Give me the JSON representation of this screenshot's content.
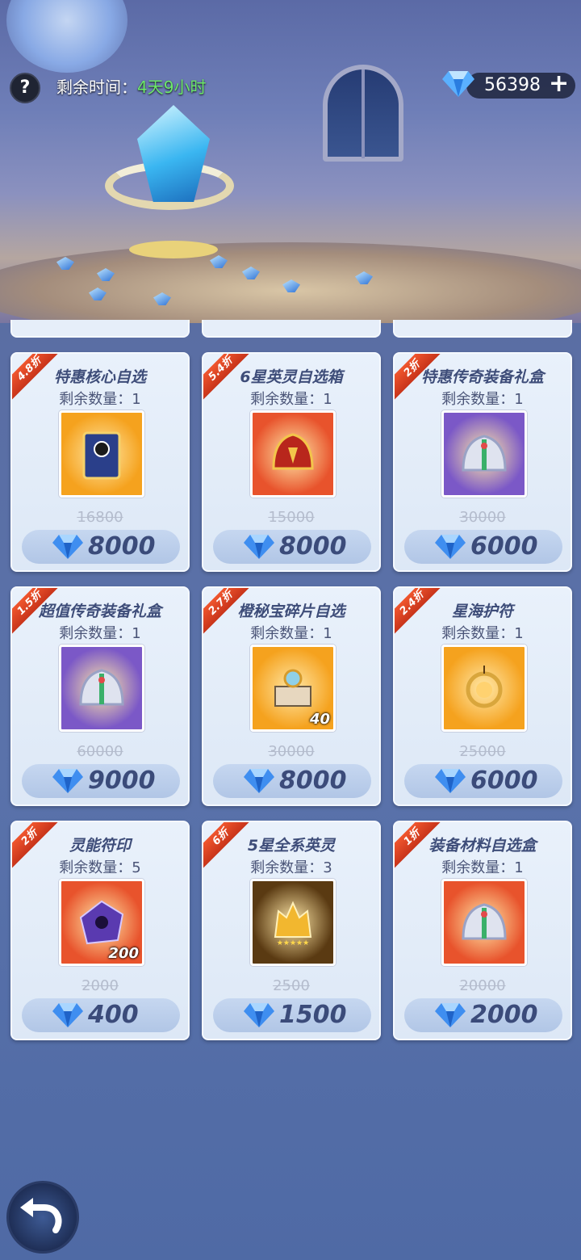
{
  "header": {
    "help_icon": "question-icon",
    "time_label": "剩余时间：",
    "time_value": "4天9小时",
    "diamond_balance": "56398",
    "add_icon": "plus-icon"
  },
  "colors": {
    "ribbon": "#e24a25",
    "price_text": "#3b4b7a",
    "time_green": "#6de86a"
  },
  "items": [
    {
      "discount": "4.8折",
      "name": "特惠核心自选",
      "stock": "剩余数量：1",
      "qty": "",
      "original_price": "16800",
      "price": "8000",
      "art": "card-pack",
      "bg": "#f5a21e"
    },
    {
      "discount": "5.4折",
      "name": "6星英灵自选箱",
      "stock": "剩余数量：1",
      "qty": "",
      "original_price": "15000",
      "price": "8000",
      "art": "red-helmet",
      "bg": "#e8532c"
    },
    {
      "discount": "2折",
      "name": "特惠传奇装备礼盒",
      "stock": "剩余数量：1",
      "qty": "",
      "original_price": "30000",
      "price": "6000",
      "art": "armor-set",
      "bg": "#7b58c7"
    },
    {
      "discount": "1.5折",
      "name": "超值传奇装备礼盒",
      "stock": "剩余数量：1",
      "qty": "",
      "original_price": "60000",
      "price": "9000",
      "art": "armor-set",
      "bg": "#7b58c7"
    },
    {
      "discount": "2.7折",
      "name": "橙秘宝碎片自选",
      "stock": "剩余数量：1",
      "qty": "40",
      "original_price": "30000",
      "price": "8000",
      "art": "treasure-altar",
      "bg": "#f5a21e"
    },
    {
      "discount": "2.4折",
      "name": "星海护符",
      "stock": "剩余数量：1",
      "qty": "",
      "original_price": "25000",
      "price": "6000",
      "art": "amulet",
      "bg": "#f5a21e"
    },
    {
      "discount": "2折",
      "name": "灵能符印",
      "stock": "剩余数量：5",
      "qty": "200",
      "original_price": "2000",
      "price": "400",
      "art": "purple-seal",
      "bg": "#e8532c"
    },
    {
      "discount": "6折",
      "name": "5星全系英灵",
      "stock": "剩余数量：3",
      "qty": "",
      "original_price": "2500",
      "price": "1500",
      "art": "golden-hero",
      "bg": "#5a3a12"
    },
    {
      "discount": "1折",
      "name": "装备材料自选盒",
      "stock": "剩余数量：1",
      "qty": "",
      "original_price": "20000",
      "price": "2000",
      "art": "armor-set",
      "bg": "#e8532c"
    }
  ],
  "back_icon": "back-arrow-icon"
}
